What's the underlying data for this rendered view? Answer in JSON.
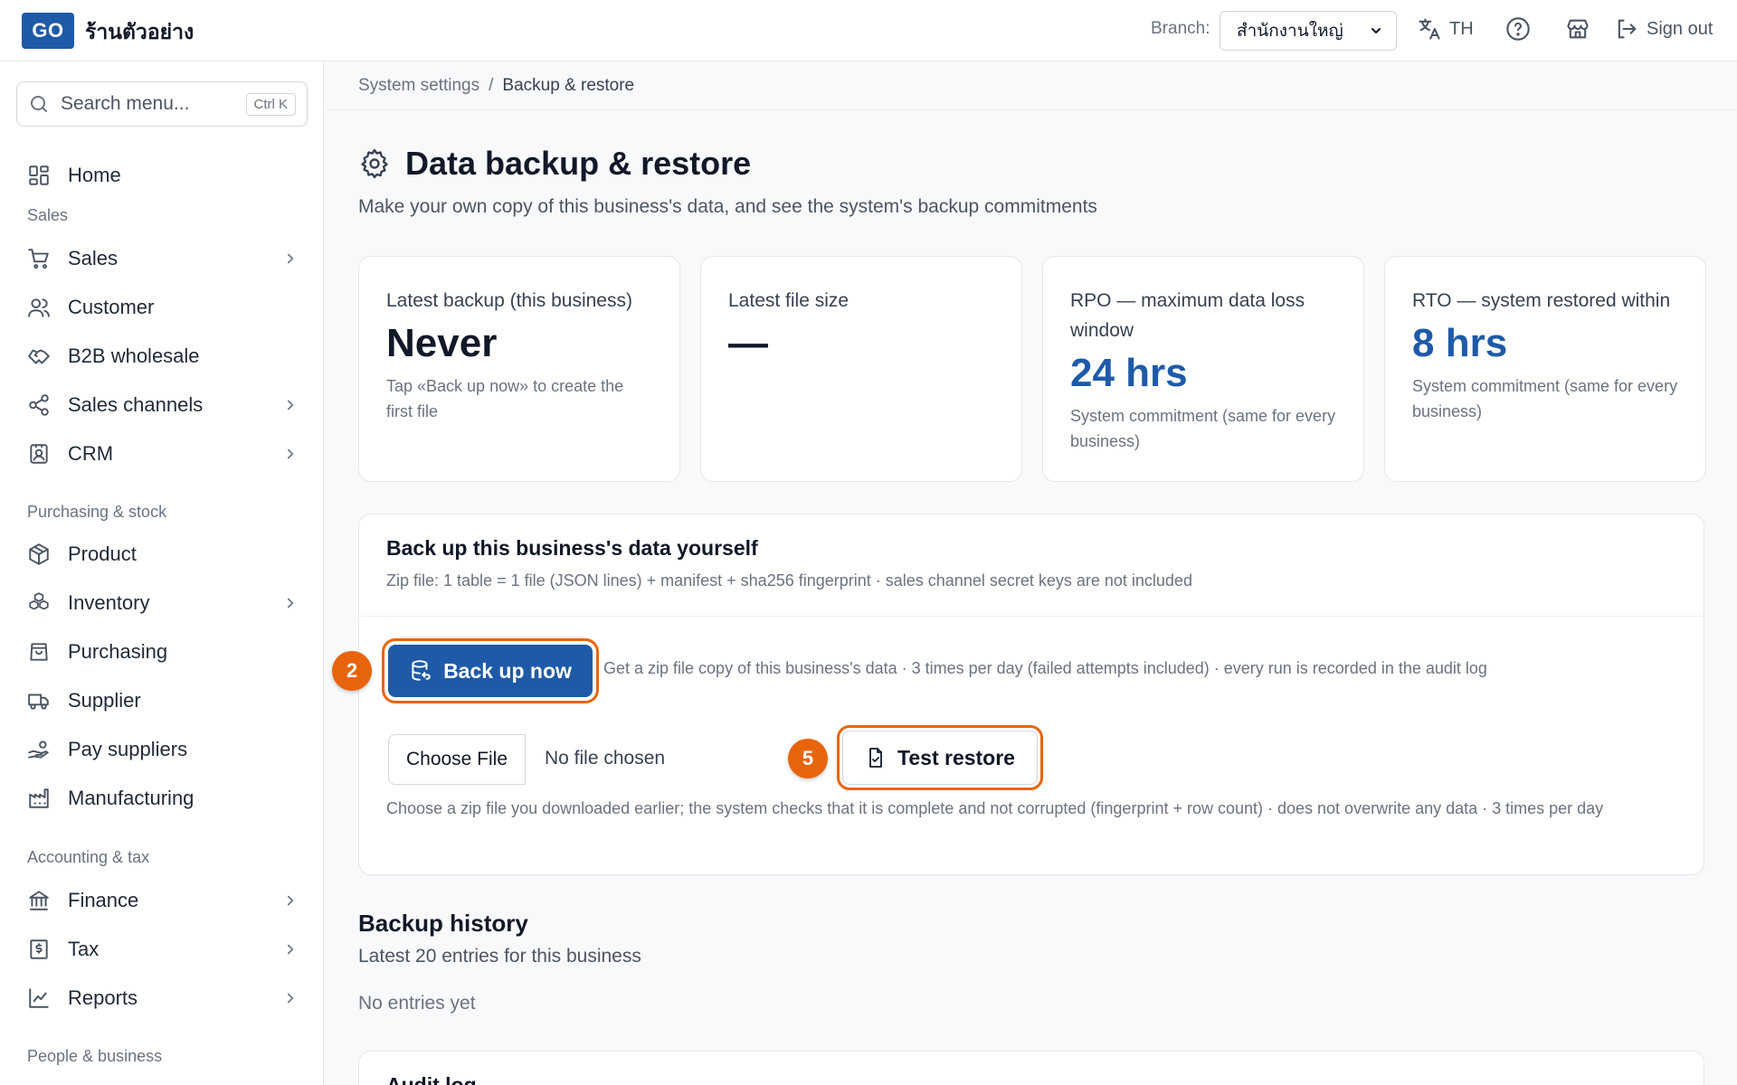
{
  "header": {
    "logo_text": "GO",
    "shop_name": "ร้านตัวอย่าง",
    "branch_label": "Branch:",
    "branch_value": "สำนักงานใหญ่",
    "language": "TH",
    "sign_out": "Sign out"
  },
  "sidebar": {
    "search_placeholder": "Search menu...",
    "search_shortcut": "Ctrl K",
    "home": "Home",
    "sections": {
      "sales": "Sales",
      "purchasing": "Purchasing & stock",
      "accounting": "Accounting & tax",
      "people": "People & business"
    },
    "items": {
      "sales": "Sales",
      "customer": "Customer",
      "b2b": "B2B wholesale",
      "sales_channels": "Sales channels",
      "crm": "CRM",
      "product": "Product",
      "inventory": "Inventory",
      "purchasing": "Purchasing",
      "supplier": "Supplier",
      "pay_suppliers": "Pay suppliers",
      "manufacturing": "Manufacturing",
      "finance": "Finance",
      "tax": "Tax",
      "reports": "Reports"
    }
  },
  "breadcrumb": {
    "parent": "System settings",
    "separator": "/",
    "current": "Backup & restore"
  },
  "page": {
    "title": "Data backup & restore",
    "subtitle": "Make your own copy of this business's data, and see the system's backup commitments"
  },
  "stats": [
    {
      "label": "Latest backup (this business)",
      "value": "Never",
      "note": "Tap «Back up now» to create the first file"
    },
    {
      "label": "Latest file size",
      "value": "—",
      "note": ""
    },
    {
      "label": "RPO — maximum data loss window",
      "value": "24 hrs",
      "note": "System commitment (same for every business)"
    },
    {
      "label": "RTO — system restored within",
      "value": "8 hrs",
      "note": "System commitment (same for every business)"
    }
  ],
  "backup_panel": {
    "title": "Back up this business's data yourself",
    "description": "Zip file: 1 table = 1 file (JSON lines) + manifest + sha256 fingerprint · sales channel secret keys are not included",
    "backup_button": "Back up now",
    "backup_hint": "Get a zip file copy of this business's data · 3 times per day (failed attempts included) · every run is recorded in the audit log",
    "choose_file": "Choose File",
    "no_file": "No file chosen",
    "test_restore": "Test restore",
    "restore_note": "Choose a zip file you downloaded earlier; the system checks that it is complete and not corrupted (fingerprint + row count) · does not overwrite any data · 3 times per day",
    "step_backup": "2",
    "step_restore": "5"
  },
  "history": {
    "title": "Backup history",
    "subtitle": "Latest 20 entries for this business",
    "empty": "No entries yet"
  },
  "audit": {
    "title": "Audit log"
  },
  "colors": {
    "brand": "#1e5aa8",
    "highlight": "#e8640c"
  }
}
